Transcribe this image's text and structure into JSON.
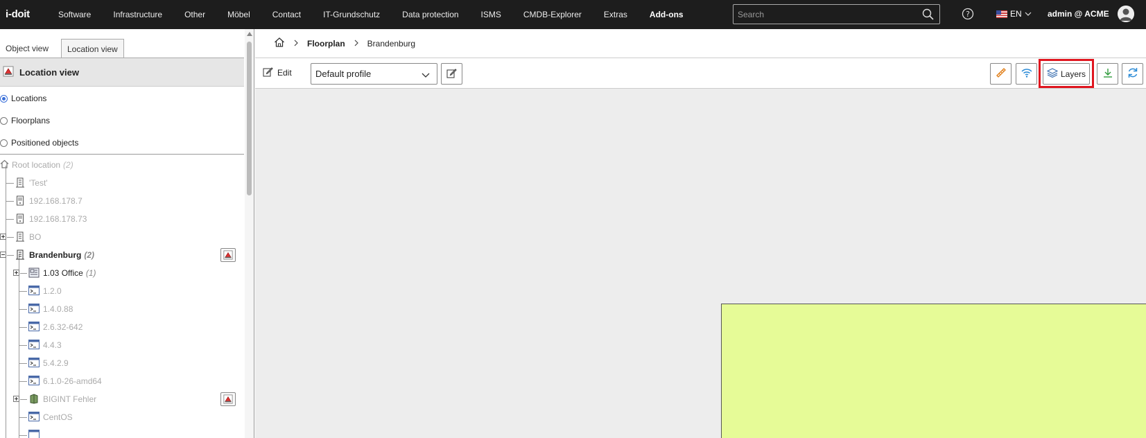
{
  "topbar": {
    "logo": "i-doit",
    "nav": [
      "Software",
      "Infrastructure",
      "Other",
      "Möbel",
      "Contact",
      "IT-Grundschutz",
      "Data protection",
      "ISMS",
      "CMDB-Explorer",
      "Extras",
      "Add-ons"
    ],
    "search_placeholder": "Search",
    "language": "EN",
    "user": "admin @ ACME"
  },
  "left": {
    "tabs": {
      "object_view": "Object view",
      "location_view": "Location view"
    },
    "header_title": "Location view",
    "radios": {
      "locations": "Locations",
      "floorplans": "Floorplans",
      "positioned": "Positioned objects",
      "selected": "Locations"
    },
    "tree": {
      "root": {
        "label": "Root location",
        "count": "(2)"
      },
      "test": "'Test'",
      "ip1": "192.168.178.7",
      "ip2": "192.168.178.73",
      "bo": "BO",
      "brandenburg": {
        "label": "Brandenburg",
        "count": "(2)"
      },
      "office": {
        "label": "1.03 Office",
        "count": "(1)"
      },
      "os": [
        "1.2.0",
        "1.4.0.88",
        "2.6.32-642",
        "4.4.3",
        "5.4.2.9",
        "6.1.0-26-amd64"
      ],
      "bigint": "BIGINT Fehler",
      "centos": "CentOS"
    }
  },
  "right": {
    "breadcrumb": {
      "floorplan": "Floorplan",
      "location": "Brandenburg"
    },
    "toolbar": {
      "edit_label": "Edit",
      "profile": "Default profile",
      "layers_label": "Layers"
    },
    "colors": {
      "room_fill": "#e6fb97",
      "highlight": "#e0161f",
      "accent": "#3a6fd8"
    }
  }
}
